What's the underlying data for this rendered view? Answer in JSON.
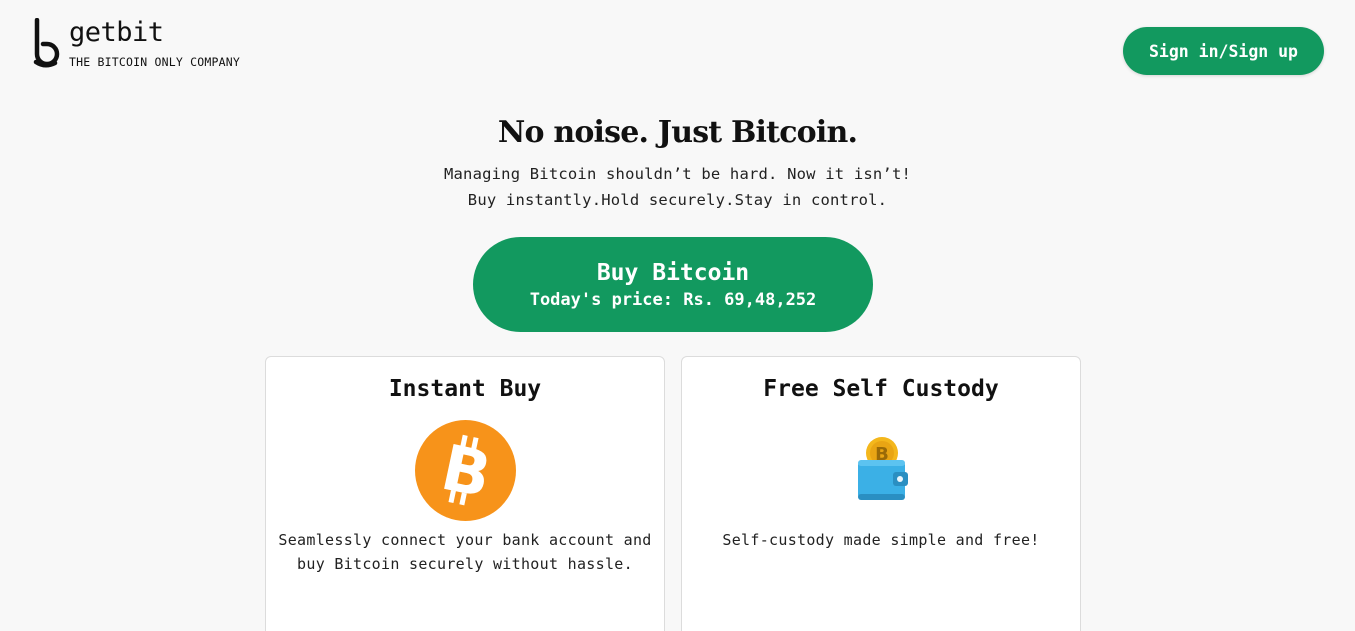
{
  "header": {
    "brand_name": "getbit",
    "tagline": "THE BITCOIN ONLY COMPANY",
    "signin_label": "Sign in/Sign up"
  },
  "hero": {
    "title": "No noise. Just Bitcoin.",
    "subtitle_line1": "Managing Bitcoin shouldn’t be hard. Now it isn’t!",
    "subtitle_line2": "Buy instantly.Hold securely.Stay in control.",
    "buy_label": "Buy Bitcoin",
    "price_text": "Today's price: Rs. 69,48,252"
  },
  "cards": [
    {
      "title": "Instant Buy",
      "icon": "bitcoin-icon",
      "description": "Seamlessly connect your bank account and buy Bitcoin securely without hassle."
    },
    {
      "title": "Free Self Custody",
      "icon": "wallet-icon",
      "description": "Self-custody made simple and free!"
    }
  ],
  "colors": {
    "accent": "#12995f",
    "background": "#f8f8f8",
    "bitcoin_orange": "#f7931a",
    "wallet_blue": "#3bb0e6"
  }
}
